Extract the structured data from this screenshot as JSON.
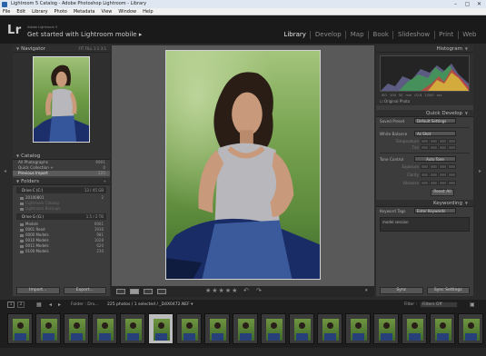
{
  "window": {
    "title": "Lightroom 5 Catalog - Adobe Photoshop Lightroom - Library",
    "buttons": [
      "–",
      "▢",
      "✕"
    ]
  },
  "menu": [
    "File",
    "Edit",
    "Library",
    "Photo",
    "Metadata",
    "View",
    "Window",
    "Help"
  ],
  "identity": {
    "logo": "Lr",
    "small": "Adobe Lightroom 5",
    "big": "Get started with Lightroom mobile ▸"
  },
  "modules": [
    "Library",
    "Develop",
    "Map",
    "Book",
    "Slideshow",
    "Print",
    "Web"
  ],
  "active_module": "Library",
  "left_panel": {
    "navigator": {
      "title": "Navigator",
      "zoom": "FIT  FILL  1:1  3:1"
    },
    "catalog": {
      "title": "Catalog",
      "items": [
        {
          "label": "All Photographs",
          "count": "6901"
        },
        {
          "label": "Quick Collection +",
          "count": "0"
        },
        {
          "label": "Previous Import",
          "count": "225"
        }
      ]
    },
    "folders": {
      "title": "Folders",
      "drive1": {
        "label": "Drive C (C:)",
        "count": "13 / 45 GB"
      },
      "drive1_folders": [
        {
          "label": "20100801",
          "count": "2"
        },
        {
          "label": "Lightroom Catalog",
          "count": ""
        },
        {
          "label": "Lightroom Backups",
          "count": ""
        }
      ],
      "drive2": {
        "label": "Drive G (G:)",
        "count": "1.5 / 2 TB"
      },
      "drive2_folders": [
        {
          "label": "Models",
          "count": "6901"
        },
        {
          "label": "0001 Read",
          "count": "1916"
        },
        {
          "label": "0000 Models",
          "count": "981"
        },
        {
          "label": "0010 Models",
          "count": "1028"
        },
        {
          "label": "0011 Models",
          "count": "620"
        },
        {
          "label": "0100 Models",
          "count": "210"
        }
      ]
    },
    "import_btn": "Import...",
    "export_btn": "Export..."
  },
  "right_panel": {
    "histogram": {
      "title": "Histogram",
      "info": "ISO 100   50 mm   f/2.8   1/500 sec",
      "original": "Original Photo"
    },
    "quick_develop": {
      "title": "Quick Develop",
      "saved_preset_label": "Saved Preset",
      "saved_preset_value": "Default Settings",
      "white_balance_label": "White Balance",
      "white_balance_value": "As Shot",
      "temperature": "Temperature",
      "tint": "Tint",
      "tone_control": "Tone Control",
      "auto_tone": "Auto Tone",
      "exposure": "Exposure",
      "clarity": "Clarity",
      "vibrance": "Vibrance",
      "reset_all": "Reset All"
    },
    "keywording": {
      "title": "Keywording",
      "keyword_tags_label": "Keyword Tags",
      "keyword_tags_value": "Enter Keywords",
      "keywords": "model session"
    },
    "sync_btn": "Sync",
    "sync_settings_btn": "Sync Settings"
  },
  "toolbar": {
    "stars": "★★★★★"
  },
  "filmstrip_bar": {
    "pages": [
      "1",
      "2"
    ],
    "path": "Folder : Drv...",
    "info": "225 photos / 1 selected / _D4X0472.NEF ▾",
    "filter_label": "Filter :",
    "filter_value": "Filters Off"
  },
  "thumb_count": 18,
  "selected_thumb": 5
}
